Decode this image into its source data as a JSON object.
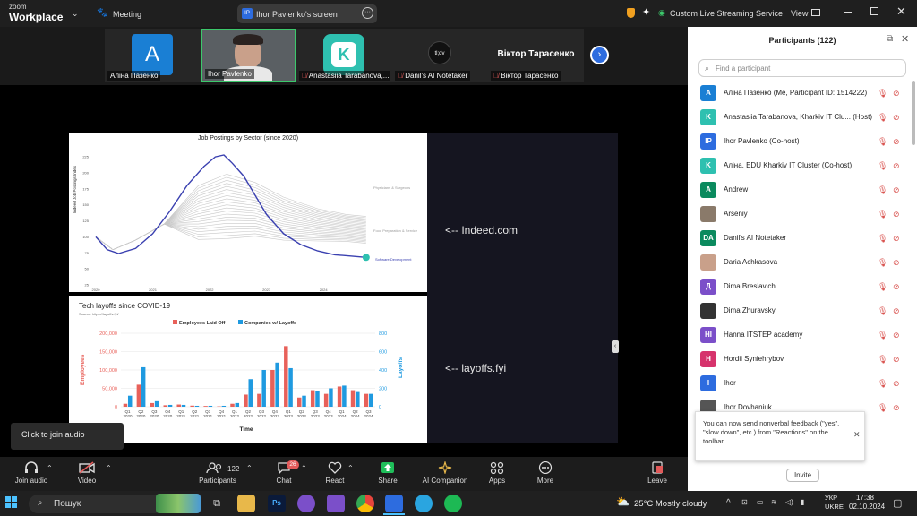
{
  "titlebar": {
    "brand_line1": "zoom",
    "brand_line2": "Workplace",
    "meeting_label": "Meeting",
    "share_badge": "IP",
    "share_title": "Ihor Pavlenko's screen",
    "streaming_label": "Custom Live Streaming Service",
    "view_label": "View"
  },
  "thumbnails": [
    {
      "name": "Аліна Пазенко",
      "initial": "A",
      "color": "#1a7fd4"
    },
    {
      "name": "Ihor Pavlenko",
      "initial": "",
      "color": "#3a3a3a"
    },
    {
      "name": "Anastasiia Tarabanova,...",
      "initial": "K",
      "color": "#2ec0b0"
    },
    {
      "name": "Danil's AI Notetaker",
      "initial": "tl;dv",
      "color": "#222"
    },
    {
      "name": "Віктор Тарасенко",
      "initial": "",
      "color": "#262626",
      "big_label": "Віктор Тарасенко"
    }
  ],
  "stage": {
    "note1": "<-- Indeed.com",
    "note2": "<-- layoffs.fyi"
  },
  "chart_data": [
    {
      "type": "line",
      "title": "Job Postings by Sector (since 2020)",
      "xlabel": "",
      "ylabel": "Indeed Job Postings Index",
      "x": [
        "2020",
        "2021",
        "2022",
        "2023",
        "2024"
      ],
      "yticks": [
        25,
        50,
        75,
        100,
        125,
        150,
        175,
        200,
        225
      ],
      "ylim": [
        25,
        235
      ],
      "series_labels": [
        "Physicians & Surgeons",
        "Food Preparation & Service",
        "Software Development"
      ],
      "highlight": {
        "name": "Software Development",
        "x": [
          2020.0,
          2020.2,
          2020.4,
          2020.7,
          2021.0,
          2021.3,
          2021.6,
          2021.9,
          2022.1,
          2022.25,
          2022.4,
          2022.6,
          2022.8,
          2023.0,
          2023.3,
          2023.6,
          2023.9,
          2024.2,
          2024.5,
          2024.75
        ],
        "y": [
          100,
          80,
          74,
          82,
          105,
          140,
          180,
          210,
          225,
          228,
          215,
          195,
          165,
          135,
          105,
          88,
          78,
          72,
          70,
          68
        ]
      }
    },
    {
      "type": "bar",
      "title": "Tech layoffs since COVID-19",
      "subtitle": "Source: https://layoffs.fyi/",
      "xlabel": "Time",
      "ylabel": "Employees",
      "y2label": "Layoffs",
      "ylim": [
        0,
        200000
      ],
      "y2lim": [
        0,
        800
      ],
      "yticks": [
        "0",
        "50,000",
        "100,000",
        "150,000",
        "200,000"
      ],
      "y2ticks": [
        "0",
        "200",
        "400",
        "600",
        "800"
      ],
      "categories": [
        "Q1 2020",
        "Q2 2020",
        "Q3 2020",
        "Q4 2020",
        "Q1 2021",
        "Q2 2021",
        "Q3 2021",
        "Q4 2021",
        "Q1 2022",
        "Q2 2022",
        "Q3 2022",
        "Q4 2022",
        "Q1 2023",
        "Q2 2023",
        "Q3 2023",
        "Q4 2023",
        "Q1 2024",
        "Q2 2024",
        "Q3 2024"
      ],
      "series": [
        {
          "name": "Employees Laid Off",
          "color": "#e8615a",
          "values": [
            8000,
            60000,
            10000,
            4000,
            6000,
            3000,
            2000,
            1000,
            8000,
            33000,
            35000,
            100000,
            165000,
            25000,
            45000,
            35000,
            55000,
            45000,
            35000
          ]
        },
        {
          "name": "Companies w/ Layoffs",
          "color": "#1f9ae0",
          "values": [
            120,
            430,
            60,
            20,
            20,
            10,
            10,
            10,
            40,
            300,
            400,
            480,
            420,
            120,
            170,
            200,
            230,
            160,
            140
          ]
        }
      ],
      "colors": {
        "employees": "#e8615a",
        "companies": "#1f9ae0"
      }
    }
  ],
  "toolbar": {
    "tooltip": "Click to join audio",
    "join_audio": "Join audio",
    "video": "Video",
    "participants": "Participants",
    "participants_count": "122",
    "chat": "Chat",
    "chat_badge": "26",
    "react": "React",
    "share": "Share",
    "ai_companion": "AI Companion",
    "apps": "Apps",
    "more": "More",
    "leave": "Leave"
  },
  "participants_panel": {
    "title": "Participants (122)",
    "search_placeholder": "Find a participant",
    "feedback_text": "You can now send nonverbal feedback (\"yes\", \"slow down\", etc.) from \"Reactions\" on the toolbar.",
    "invite_label": "Invite",
    "list": [
      {
        "name": "Аліна Пазенко (Me, Participant ID: 1514222)",
        "initial": "A",
        "color": "#1a7fd4"
      },
      {
        "name": "Anastasiia Tarabanova, Kharkiv IT Clu... (Host)",
        "initial": "K",
        "color": "#2ec0b0"
      },
      {
        "name": "Ihor Pavlenko (Co-host)",
        "initial": "IP",
        "color": "#2d6cdf"
      },
      {
        "name": "Аліна, EDU Kharkiv IT Cluster (Co-host)",
        "initial": "K",
        "color": "#2ec0b0"
      },
      {
        "name": "Andrew",
        "initial": "A",
        "color": "#0b8a5e"
      },
      {
        "name": "Arseniy",
        "initial": "",
        "color": "#8a7a6a"
      },
      {
        "name": "Danil's AI Notetaker",
        "initial": "DA",
        "color": "#0b8a5e"
      },
      {
        "name": "Daria Achkasova",
        "initial": "",
        "color": "#c9a08a"
      },
      {
        "name": "Dima Breslavich",
        "initial": "Д",
        "color": "#7b4fc9"
      },
      {
        "name": "Dima Zhuravsky",
        "initial": "",
        "color": "#333"
      },
      {
        "name": "Hanna ITSTEP academy",
        "initial": "HI",
        "color": "#7b4fc9"
      },
      {
        "name": "Hordii Syniehrybov",
        "initial": "H",
        "color": "#d6336c"
      },
      {
        "name": "Ihor",
        "initial": "I",
        "color": "#2d6cdf"
      },
      {
        "name": "Ihor Dovhaniuk",
        "initial": "",
        "color": "#555"
      }
    ]
  },
  "taskbar": {
    "search_label": "Пошук",
    "weather": "25°C  Mostly cloudy",
    "lang_line1": "УКР",
    "lang_line2": "UKRE",
    "time": "17:38",
    "date": "02.10.2024"
  }
}
